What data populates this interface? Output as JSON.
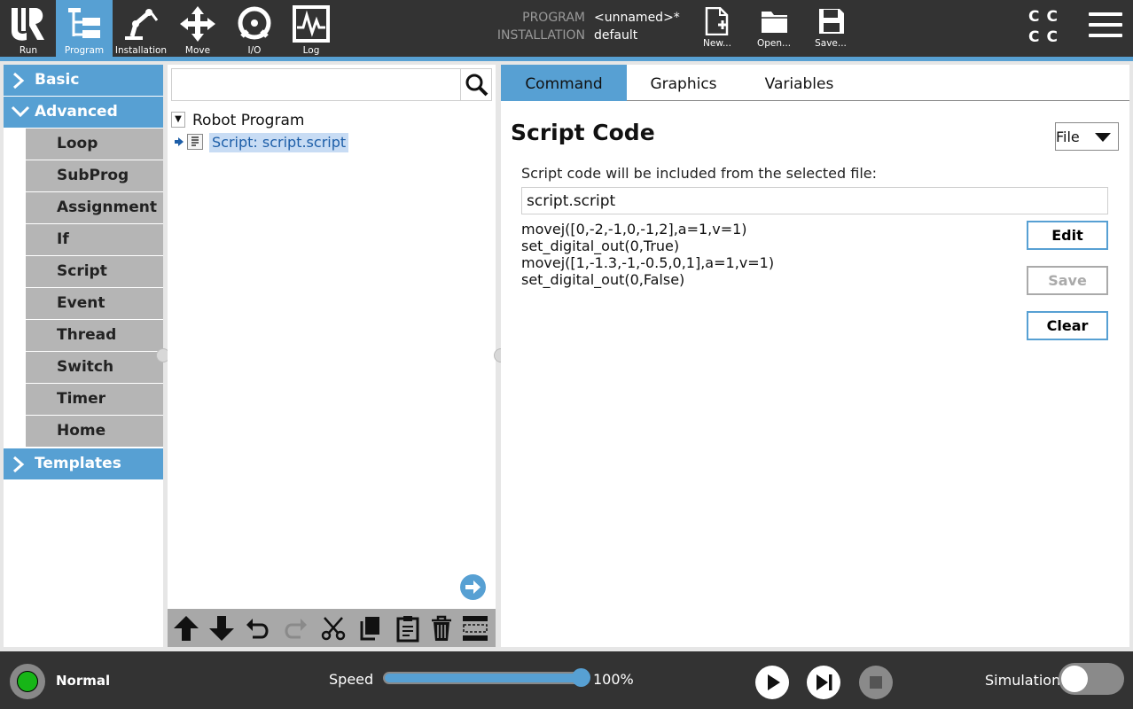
{
  "header": {
    "nav": [
      {
        "label": "Run",
        "icon": "ur-logo-icon"
      },
      {
        "label": "Program",
        "icon": "program-icon",
        "active": true
      },
      {
        "label": "Installation",
        "icon": "robot-arm-icon"
      },
      {
        "label": "Move",
        "icon": "move-arrows-icon"
      },
      {
        "label": "I/O",
        "icon": "io-icon"
      },
      {
        "label": "Log",
        "icon": "log-icon"
      }
    ],
    "program_key": "PROGRAM",
    "program_val": "<unnamed>*",
    "installation_key": "INSTALLATION",
    "installation_val": "default",
    "file_buttons": [
      {
        "label": "New...",
        "icon": "new-file-icon"
      },
      {
        "label": "Open...",
        "icon": "open-folder-icon"
      },
      {
        "label": "Save...",
        "icon": "save-icon"
      }
    ],
    "cc_indicator": [
      "C",
      "C",
      "C",
      "C"
    ],
    "accent": "#57a0d3"
  },
  "sidebar": {
    "categories": [
      {
        "label": "Basic",
        "expanded": false
      },
      {
        "label": "Advanced",
        "expanded": true
      },
      {
        "label": "Templates",
        "expanded": false
      }
    ],
    "advanced_items": [
      "Loop",
      "SubProg",
      "Assignment",
      "If",
      "Script",
      "Event",
      "Thread",
      "Switch",
      "Timer",
      "Home"
    ]
  },
  "tree": {
    "search_placeholder": "",
    "root": "Robot Program",
    "nodes": [
      {
        "label": "Script: script.script",
        "selected": true
      }
    ]
  },
  "command": {
    "tabs": [
      "Command",
      "Graphics",
      "Variables"
    ],
    "active_tab": "Command",
    "title": "Script Code",
    "source_select": "File",
    "description": "Script code will be included from the selected file:",
    "file_name": "script.script",
    "code_lines": [
      "movej([0,-2,-1,0,-1,2],a=1,v=1)",
      "set_digital_out(0,True)",
      "movej([1,-1.3,-1,-0.5,0,1],a=1,v=1)",
      "set_digital_out(0,False)"
    ],
    "buttons": {
      "edit": "Edit",
      "save": "Save",
      "clear": "Clear"
    }
  },
  "footer": {
    "status": "Normal",
    "status_color": "#17b517",
    "speed_label": "Speed",
    "speed_value": "100%",
    "speed_fraction": 1.0,
    "simulation_label": "Simulation",
    "simulation_on": false
  }
}
